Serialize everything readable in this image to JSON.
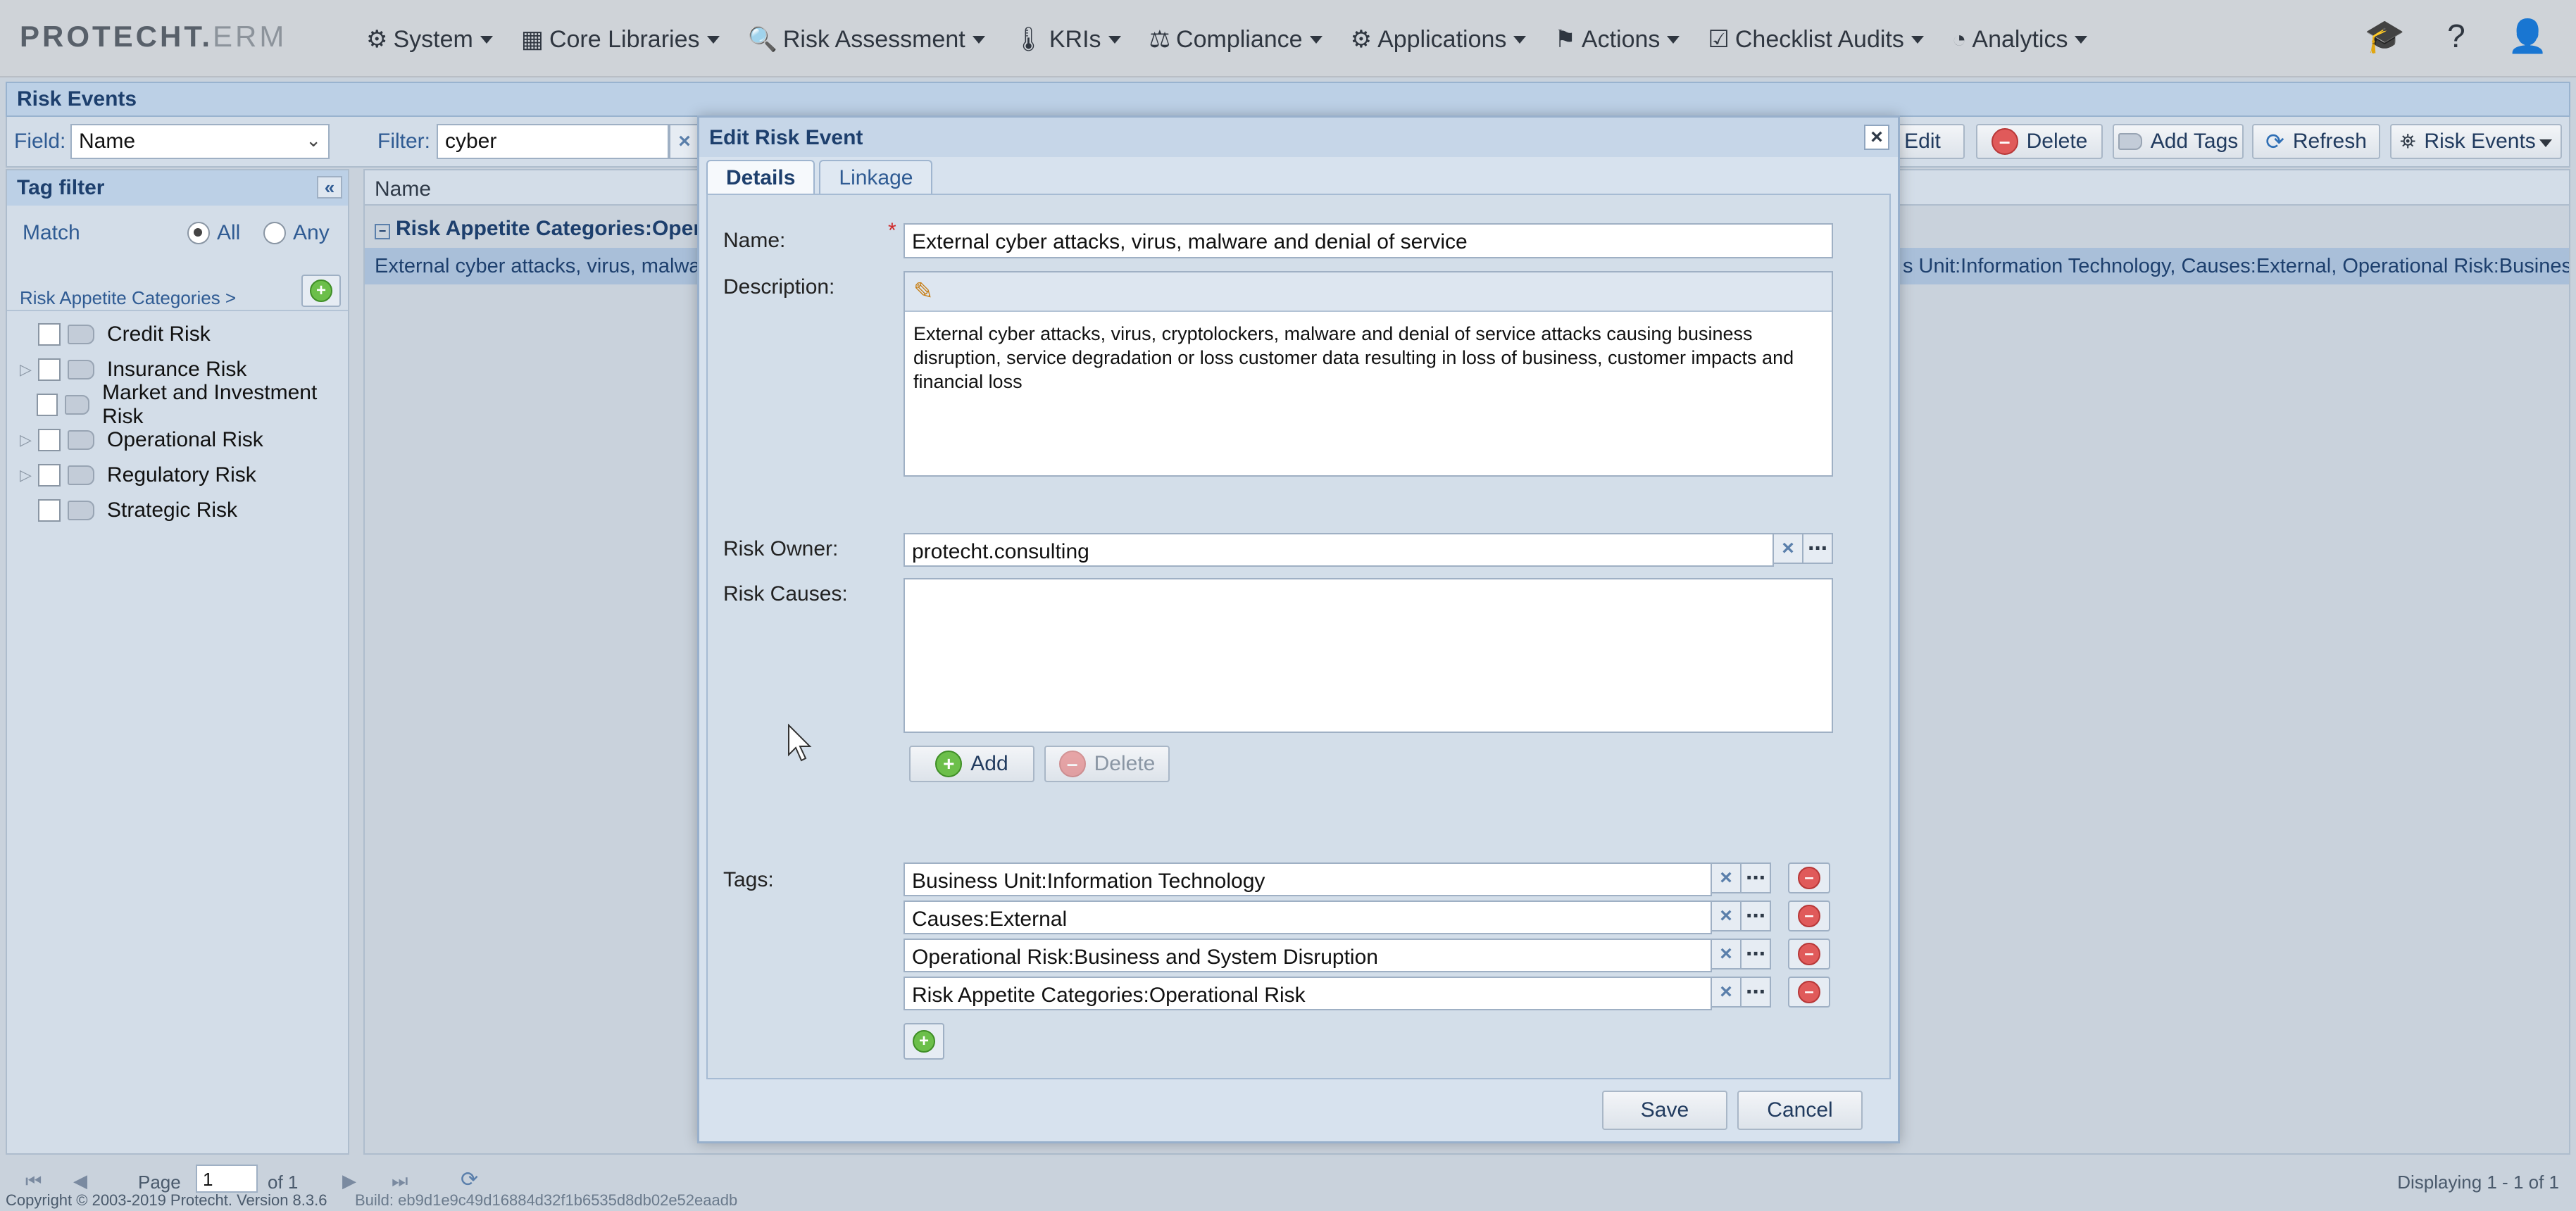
{
  "app": {
    "logo_main": "PROTECHT.",
    "logo_sub": "ERM",
    "menu": [
      {
        "icon": "gear-icon",
        "glyph": "⚙",
        "label": "System"
      },
      {
        "icon": "library-icon",
        "glyph": "▦",
        "label": "Core Libraries"
      },
      {
        "icon": "clipboard-search-icon",
        "glyph": "🔍",
        "label": "Risk Assessment"
      },
      {
        "icon": "thermometer-icon",
        "glyph": "🌡",
        "label": "KRIs"
      },
      {
        "icon": "scales-icon",
        "glyph": "⚖",
        "label": "Compliance"
      },
      {
        "icon": "gear-icon",
        "glyph": "⚙",
        "label": "Applications"
      },
      {
        "icon": "flag-icon",
        "glyph": "⚑",
        "label": "Actions"
      },
      {
        "icon": "checklist-icon",
        "glyph": "☑",
        "label": "Checklist Audits"
      },
      {
        "icon": "chart-pie-icon",
        "glyph": "◔",
        "label": "Analytics"
      }
    ],
    "top_icons": [
      {
        "name": "graduation-cap-icon",
        "glyph": "🎓"
      },
      {
        "name": "help-icon",
        "glyph": "?"
      },
      {
        "name": "user-icon",
        "glyph": "👤"
      }
    ]
  },
  "page": {
    "title": "Risk Events",
    "field_label": "Field:",
    "field_value": "Name",
    "filter_label": "Filter:",
    "filter_value": "cyber",
    "toolbar": {
      "edit": "Edit",
      "delete": "Delete",
      "add_tags": "Add Tags",
      "refresh": "Refresh",
      "risk_events": "Risk Events"
    }
  },
  "tag_filter": {
    "title": "Tag filter",
    "collapse": "«",
    "match_label": "Match",
    "all_label": "All",
    "any_label": "Any",
    "category_link": "Risk Appetite Categories >",
    "items": [
      {
        "label": "Credit Risk",
        "expandable": false
      },
      {
        "label": "Insurance Risk",
        "expandable": true
      },
      {
        "label": "Market and Investment Risk",
        "expandable": false
      },
      {
        "label": "Operational Risk",
        "expandable": true
      },
      {
        "label": "Regulatory Risk",
        "expandable": true
      },
      {
        "label": "Strategic Risk",
        "expandable": false
      }
    ]
  },
  "grid": {
    "column_name": "Name",
    "group_label": "Risk Appetite Categories:Operat",
    "row_left": "External cyber attacks, virus, malware a",
    "row_right": "s Unit:Information Technology, Causes:External, Operational Risk:Business ..."
  },
  "status": {
    "page_label": "Page",
    "page_value": "1",
    "of_label": "of 1",
    "displaying": "Displaying 1 - 1 of 1",
    "copyright": "Copyright © 2003-2019 Protecht.  Version 8.3.6",
    "build": "Build: eb9d1e9c49d16884d32f1b6535d8db02e52eaadb"
  },
  "dialog": {
    "title": "Edit Risk Event",
    "close": "×",
    "tabs": [
      "Details",
      "Linkage"
    ],
    "name_label": "Name:",
    "name_value": "External cyber attacks, virus, malware and denial of service",
    "description_label": "Description:",
    "description_value": "External cyber attacks, virus, cryptolockers, malware and denial of service attacks causing business disruption, service degradation or loss customer data resulting in loss of business, customer impacts and financial loss",
    "owner_label": "Risk Owner:",
    "owner_value": "protecht.consulting",
    "causes_label": "Risk Causes:",
    "add_label": "Add",
    "delete_label": "Delete",
    "tags_label": "Tags:",
    "tags": [
      "Business Unit:Information Technology",
      "Causes:External",
      "Operational Risk:Business and System Disruption",
      "Risk Appetite Categories:Operational Risk"
    ],
    "save_label": "Save",
    "cancel_label": "Cancel"
  }
}
